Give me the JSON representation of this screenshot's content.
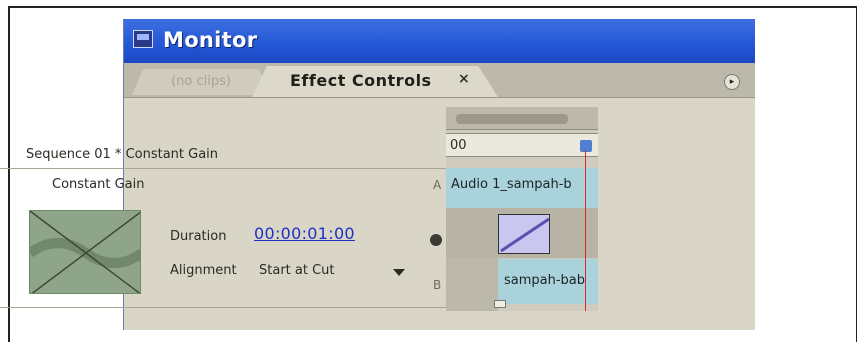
{
  "window": {
    "title": "Monitor"
  },
  "tabs": [
    {
      "label": "(no clips)",
      "active": false
    },
    {
      "label": "Effect Controls",
      "active": true,
      "close": "×"
    }
  ],
  "panel_menu_icon": "panel-menu-icon",
  "effect_panel": {
    "sequence_path": "Sequence 01 * Constant Gain",
    "transition_name": "Constant Gain",
    "duration_label": "Duration",
    "duration_value": "00:00:01:00",
    "alignment_label": "Alignment",
    "alignment_value": "Start at Cut",
    "side_a": "A",
    "side_b": "B"
  },
  "timeline": {
    "timecode": "00",
    "clip_a_label": "Audio 1_sampah-b",
    "clip_b_label": "sampah-bab"
  },
  "colors": {
    "titlebar": "#2456d6",
    "clip": "#aad2da",
    "playhead": "#d12a2a",
    "duration_link": "#1e2fc4"
  }
}
